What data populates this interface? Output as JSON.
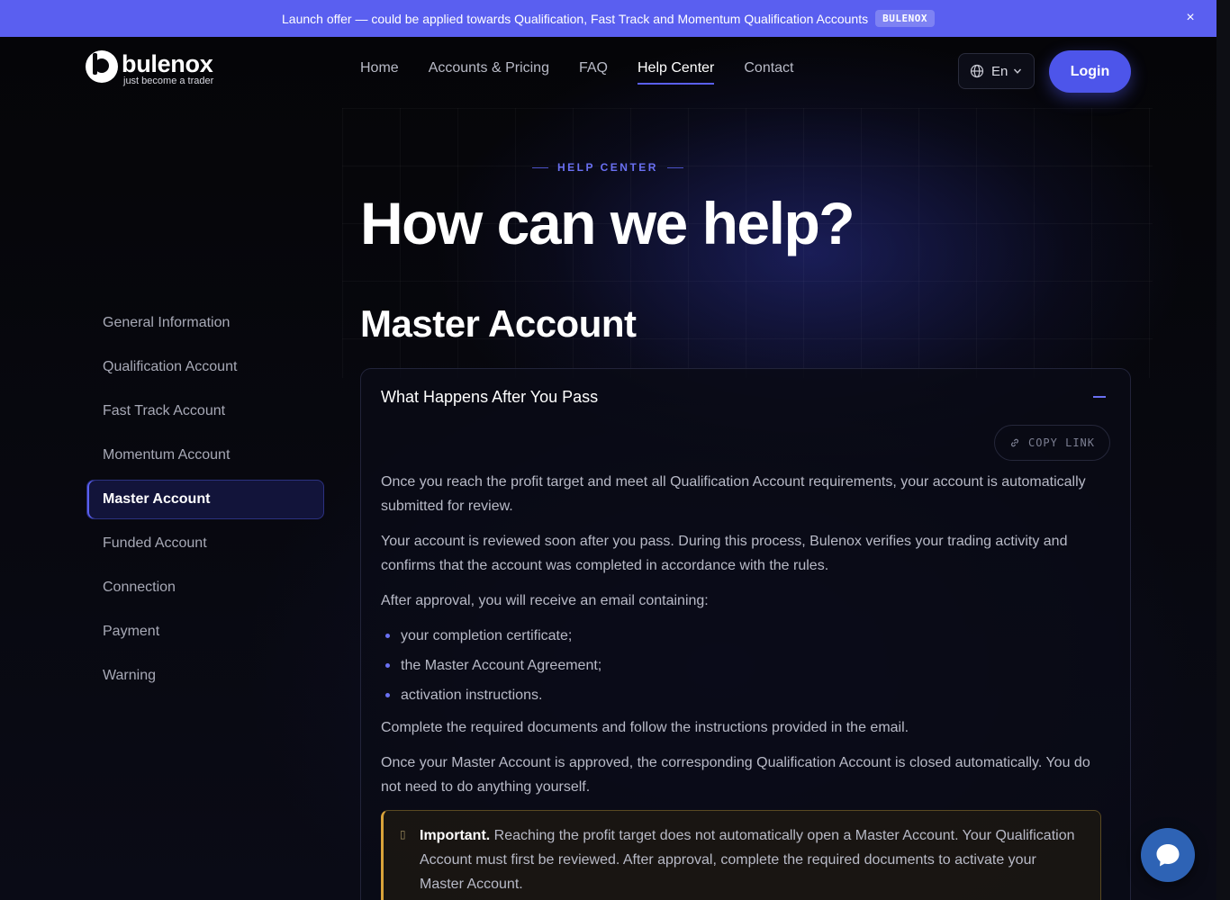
{
  "promo": {
    "text": "Launch offer — could be applied towards Qualification, Fast Track and Momentum Qualification Accounts",
    "badge": "BULENOX",
    "close_glyph": "×"
  },
  "brand": {
    "name": "bulenox",
    "tagline": "just become a trader"
  },
  "nav": {
    "items": [
      {
        "label": "Home"
      },
      {
        "label": "Accounts & Pricing"
      },
      {
        "label": "FAQ"
      },
      {
        "label": "Help Center",
        "active": true
      },
      {
        "label": "Contact"
      }
    ]
  },
  "language": {
    "selected": "En"
  },
  "login": {
    "label": "Login"
  },
  "hero": {
    "eyebrow": "HELP CENTER",
    "title": "How can we help?"
  },
  "sidebar": {
    "items": [
      {
        "label": "General Information"
      },
      {
        "label": "Qualification Account"
      },
      {
        "label": "Fast Track Account"
      },
      {
        "label": "Momentum Account"
      },
      {
        "label": "Master Account",
        "active": true
      },
      {
        "label": "Funded Account"
      },
      {
        "label": "Connection"
      },
      {
        "label": "Payment"
      },
      {
        "label": "Warning"
      }
    ]
  },
  "section": {
    "title": "Master Account",
    "card": {
      "title": "What Happens After You Pass",
      "copy_link": "COPY LINK",
      "paragraphs": [
        "Once you reach the profit target and meet all Qualification Account requirements, your account is automatically submitted for review.",
        "Your account is reviewed soon after you pass. During this process, Bulenox verifies your trading activity and confirms that the account was completed in accordance with the rules.",
        "After approval, you will receive an email containing:"
      ],
      "bullets": [
        "your completion certificate;",
        "the Master Account Agreement;",
        "activation instructions."
      ],
      "paragraphs_after": [
        "Complete the required documents and follow the instructions provided in the email.",
        "Once your Master Account is approved, the corresponding Qualification Account is closed automatically. You do not need to do anything yourself."
      ],
      "notice": {
        "label": "Important.",
        "text": " Reaching the profit target does not automatically open a Master Account. Your Qualification Account must first be reviewed. After approval, complete the required documents to activate your Master Account."
      }
    }
  },
  "colors": {
    "accent": "#5a5ff0",
    "background": "#07070b",
    "notice_border": "#d9a33a",
    "chat": "#2e63b5"
  }
}
